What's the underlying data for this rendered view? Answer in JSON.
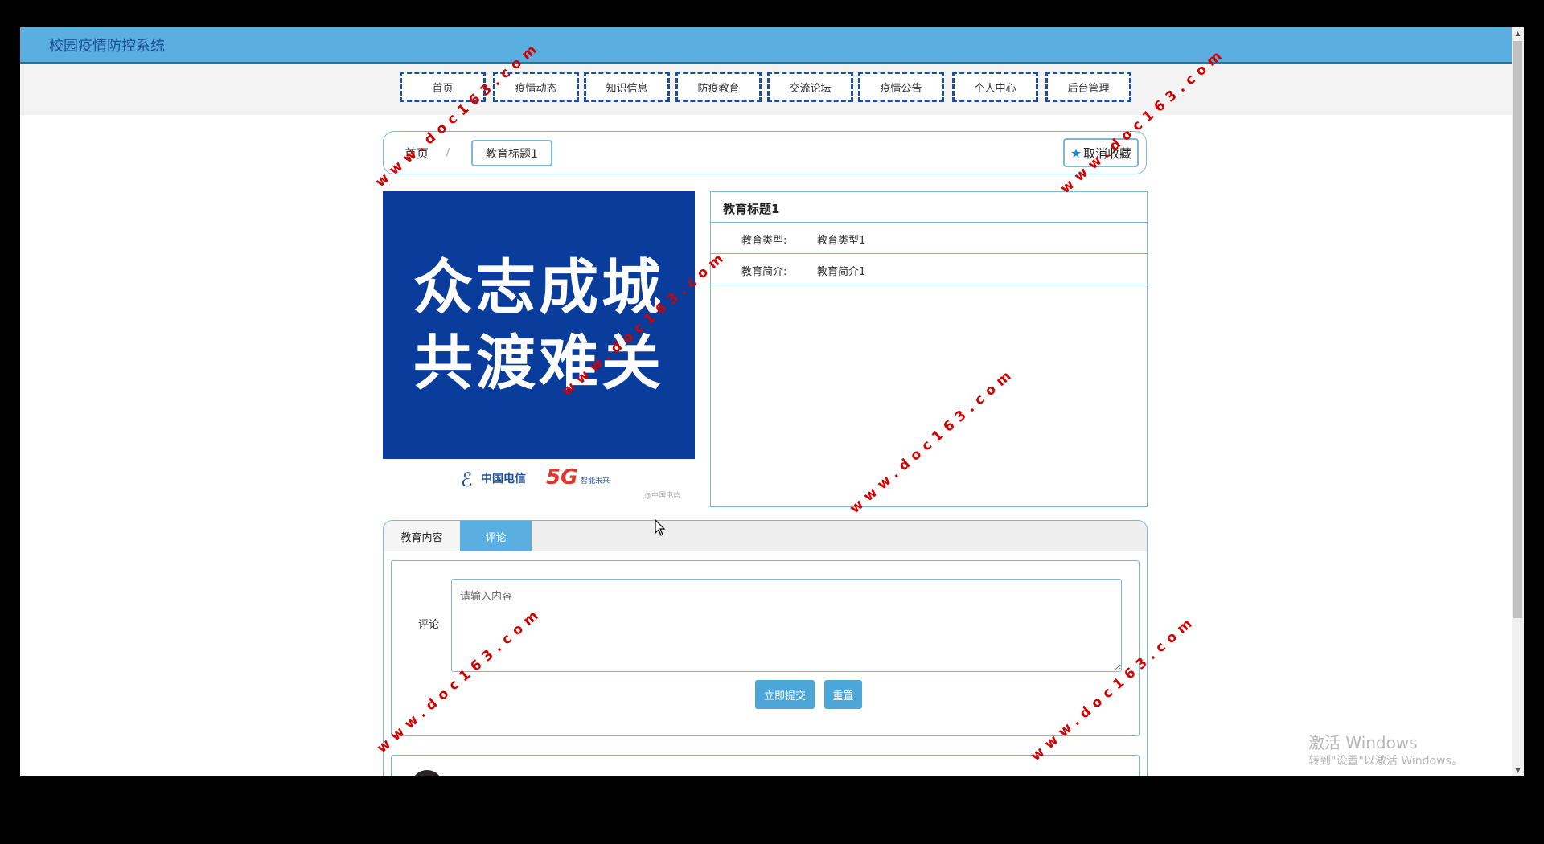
{
  "app": {
    "title": "校园疫情防控系统"
  },
  "nav": {
    "items": [
      {
        "label": "首页"
      },
      {
        "label": "疫情动态"
      },
      {
        "label": "知识信息"
      },
      {
        "label": "防疫教育"
      },
      {
        "label": "交流论坛"
      },
      {
        "label": "疫情公告"
      },
      {
        "label": "个人中心"
      },
      {
        "label": "后台管理"
      }
    ]
  },
  "breadcrumb": {
    "home": "首页",
    "separator": "/",
    "current": "教育标题1"
  },
  "favorite": {
    "label": "取消收藏",
    "icon": "star-icon"
  },
  "poster": {
    "line1": "众志成城",
    "line2": "共渡难关",
    "logo_text": "中国电信",
    "fiveg": "5G",
    "fiveg_sub": "智能未来",
    "mark": "@中国电信"
  },
  "info": {
    "title": "教育标题1",
    "rows": [
      {
        "label": "教育类型:",
        "value": "教育类型1"
      },
      {
        "label": "教育简介:",
        "value": "教育简介1"
      }
    ]
  },
  "tabs": [
    {
      "label": "教育内容",
      "active": false
    },
    {
      "label": "评论",
      "active": true
    }
  ],
  "comment_form": {
    "label": "评论",
    "placeholder": "请输入内容",
    "submit": "立即提交",
    "reset": "重置"
  },
  "watermark": {
    "text": "www.doc163.com",
    "color": "#d40000"
  },
  "windows": {
    "activate": "激活 Windows",
    "activate_sub": "转到\"设置\"以激活 Windows。"
  },
  "colors": {
    "header": "#5aaee0",
    "nav_border": "#1f4e96",
    "accent": "#4da6d8",
    "panel_border": "#7cb9d9",
    "poster_blue": "#0a3d9b"
  }
}
